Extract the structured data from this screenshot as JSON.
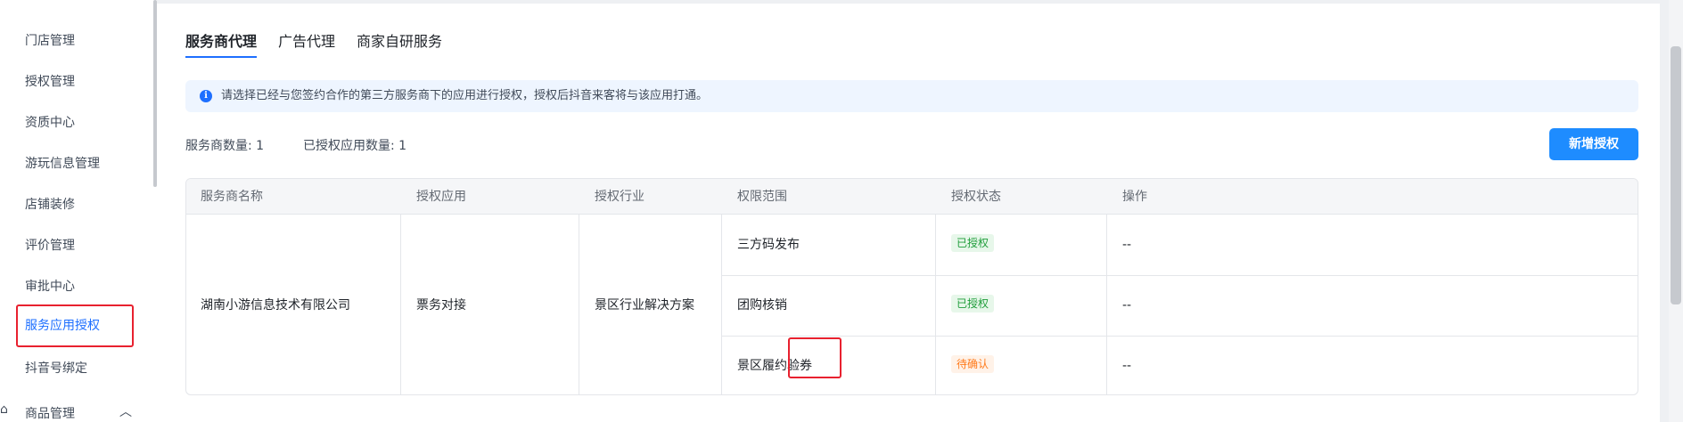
{
  "sidebar": {
    "items": [
      {
        "label": "门店管理"
      },
      {
        "label": "授权管理"
      },
      {
        "label": "资质中心"
      },
      {
        "label": "游玩信息管理"
      },
      {
        "label": "店铺装修"
      },
      {
        "label": "评价管理"
      },
      {
        "label": "审批中心"
      },
      {
        "label": "服务应用授权",
        "active": true
      },
      {
        "label": "抖音号绑定"
      }
    ],
    "group": {
      "label": "商品管理",
      "icon": "shop-icon",
      "chevron": "chevron-up-icon"
    }
  },
  "tabs": [
    {
      "label": "服务商代理",
      "active": true
    },
    {
      "label": "广告代理"
    },
    {
      "label": "商家自研服务"
    }
  ],
  "notice": {
    "icon": "info-icon",
    "text": "请选择已经与您签约合作的第三方服务商下的应用进行授权，授权后抖音来客将与该应用打通。"
  },
  "stats": {
    "provider_count": "服务商数量: 1",
    "authorized_apps": "已授权应用数量: 1"
  },
  "add_button": {
    "label": "新增授权"
  },
  "table": {
    "headers": [
      "服务商名称",
      "授权应用",
      "授权行业",
      "权限范围",
      "授权状态",
      "操作"
    ],
    "provider": "湖南小游信息技术有限公司",
    "app": "票务对接",
    "industry": "景区行业解决方案",
    "rows": [
      {
        "scope": "三方码发布",
        "status": "已授权",
        "action": "--"
      },
      {
        "scope": "团购核销",
        "status": "已授权",
        "action": "--"
      },
      {
        "scope": "景区履约验券",
        "status": "待确认",
        "action": "--"
      }
    ]
  },
  "colors": {
    "accent": "#1e6fff",
    "button": "#1e8cff",
    "authorized": "#1f9d3a",
    "pending": "#ff7a1a",
    "highlight": "#e8212f"
  }
}
